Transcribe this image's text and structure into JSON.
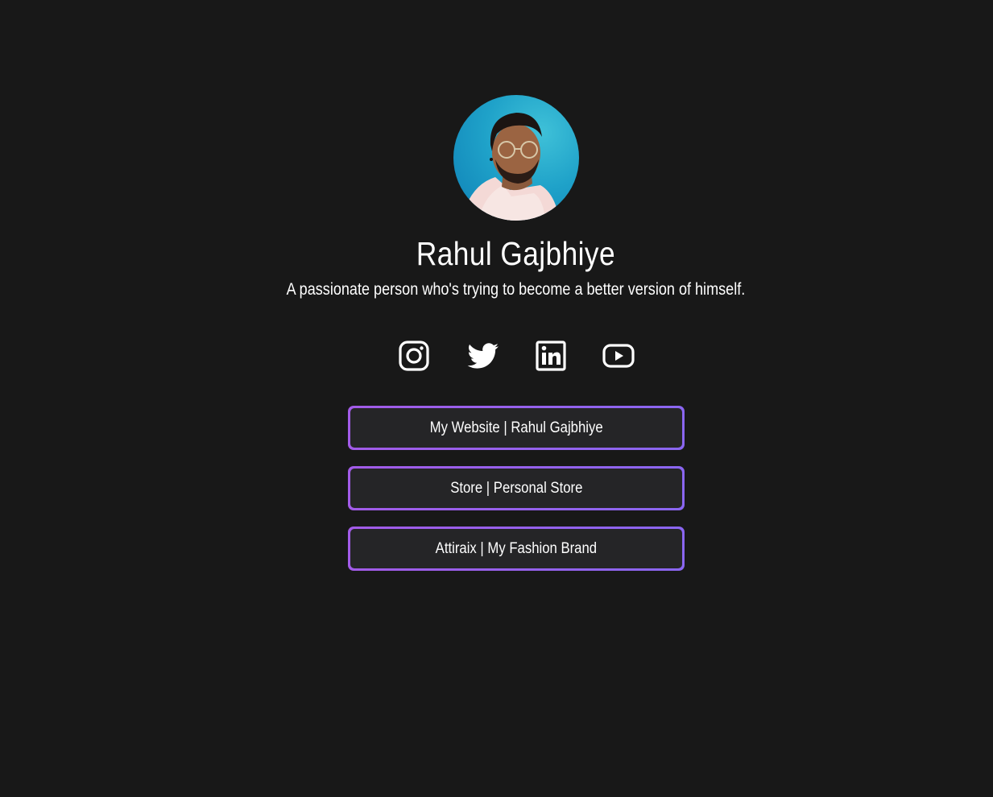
{
  "profile": {
    "name": "Rahul Gajbhiye",
    "bio": "A passionate person who's trying to become a better version of himself."
  },
  "socials": [
    {
      "icon": "instagram-icon"
    },
    {
      "icon": "twitter-icon"
    },
    {
      "icon": "linkedin-icon"
    },
    {
      "icon": "youtube-icon"
    }
  ],
  "links": [
    {
      "label": "My Website | Rahul Gajbhiye"
    },
    {
      "label": "Store | Personal Store"
    },
    {
      "label": "Attiraix | My Fashion Brand"
    }
  ],
  "colors": {
    "background": "#181818",
    "button_fill": "#252527",
    "button_border_start": "#a25be8",
    "button_border_end": "#8a66f0",
    "text": "#ffffff"
  }
}
